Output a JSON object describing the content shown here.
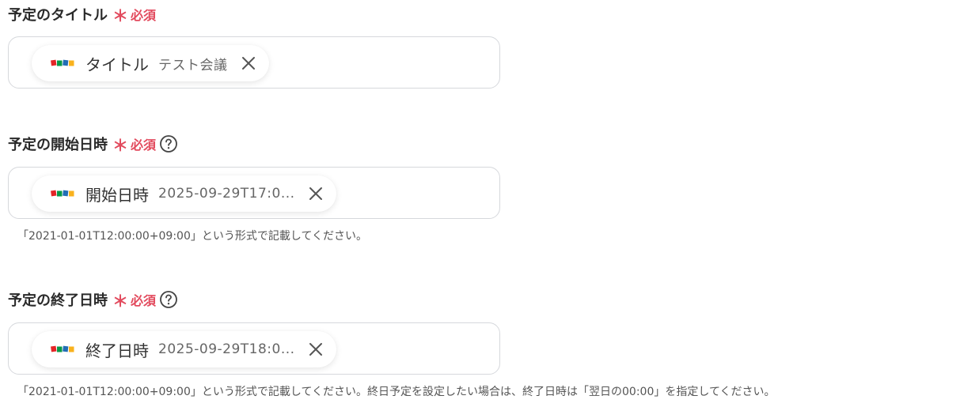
{
  "fields": [
    {
      "label": "予定のタイトル",
      "required_mark": "＊",
      "required_text": "必須",
      "has_help": false,
      "chip": {
        "app_icon": "zoho-logo-icon",
        "name": "タイトル",
        "value": "テスト会議"
      },
      "hint": ""
    },
    {
      "label": "予定の開始日時",
      "required_mark": "＊",
      "required_text": "必須",
      "has_help": true,
      "chip": {
        "app_icon": "zoho-logo-icon",
        "name": "開始日時",
        "value": "2025-09-29T17:0..."
      },
      "hint": "「2021-01-01T12:00:00+09:00」という形式で記載してください。"
    },
    {
      "label": "予定の終了日時",
      "required_mark": "＊",
      "required_text": "必須",
      "has_help": true,
      "chip": {
        "app_icon": "zoho-logo-icon",
        "name": "終了日時",
        "value": "2025-09-29T18:0..."
      },
      "hint": "「2021-01-01T12:00:00+09:00」という形式で記載してください。終日予定を設定したい場合は、終了日時は「翌日の00:00」を指定してください。"
    }
  ],
  "colors": {
    "required": "#e24a5d",
    "border": "#d6d8dc",
    "zoho_red": "#e42527",
    "zoho_green": "#089949",
    "zoho_blue": "#226db4",
    "zoho_yellow": "#f9b21d"
  }
}
